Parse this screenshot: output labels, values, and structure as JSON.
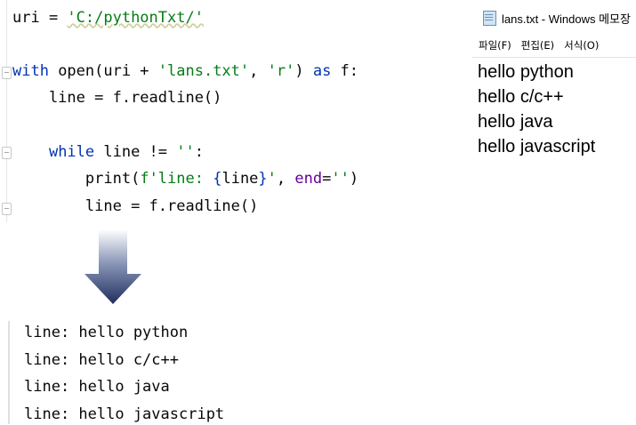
{
  "editor": {
    "lines": {
      "l1_var": "uri = ",
      "l1_str": "'C:/pythonTxt/'",
      "l3_with": "with",
      "l3_open": " open(uri + ",
      "l3_str1": "'lans.txt'",
      "l3_comma": ", ",
      "l3_str2": "'r'",
      "l3_close": ") ",
      "l3_as": "as",
      "l3_f": " f:",
      "l4": "    line = f.readline()",
      "l6_while": "while",
      "l6_rest": " line != ",
      "l6_str": "''",
      "l6_colon": ":",
      "l7_print": "print",
      "l7_paren": "(",
      "l7_fstr_a": "f'line: ",
      "l7_brace_open": "{",
      "l7_var": "line",
      "l7_brace_close": "}",
      "l7_fstr_b": "'",
      "l7_comma": ", ",
      "l7_end": "end",
      "l7_eq": "=",
      "l7_empty": "''",
      "l7_close": ")",
      "l8": "line = f.readline()"
    }
  },
  "notepad": {
    "title": "lans.txt - Windows 메모장",
    "menu": [
      "파일(F)",
      "편집(E)",
      "서식(O)"
    ],
    "content": [
      "hello python",
      "hello c/c++",
      "hello java",
      "hello javascript"
    ]
  },
  "arrow_icon": "down-arrow-icon",
  "console": {
    "output": [
      "line: hello python",
      "line: hello c/c++",
      "line: hello java",
      "line: hello javascript"
    ]
  },
  "colors": {
    "keyword": "#0033b3",
    "string": "#067d17",
    "param": "#660099",
    "arrow_top": "#ffffff",
    "arrow_bottom": "#1f2f5f"
  }
}
